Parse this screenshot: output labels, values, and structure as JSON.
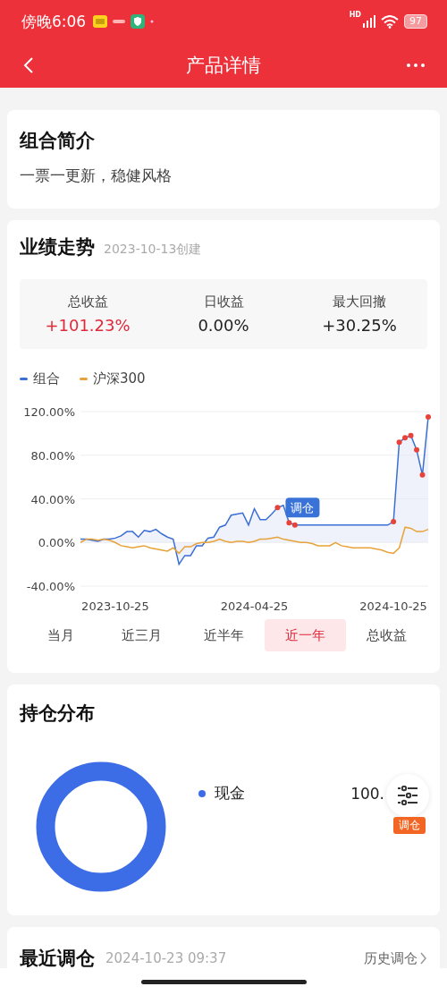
{
  "status_bar": {
    "time": "傍晚6:06",
    "network": "HD",
    "battery": "97"
  },
  "nav": {
    "title": "产品详情"
  },
  "intro": {
    "title": "组合简介",
    "text": "一票一更新，稳健风格"
  },
  "performance": {
    "title": "业绩走势",
    "created": "2023-10-13创建",
    "stats": [
      {
        "label": "总收益",
        "value": "+101.23%",
        "color": "#e0283a"
      },
      {
        "label": "日收益",
        "value": "0.00%",
        "color": "#222222"
      },
      {
        "label": "最大回撤",
        "value": "+30.25%",
        "color": "#222222"
      }
    ],
    "chart_data": {
      "type": "line",
      "categories": [
        null,
        null,
        null,
        null,
        null,
        null,
        "2023-10-25",
        null,
        null,
        null,
        null,
        null,
        null,
        null,
        null,
        null,
        null,
        null,
        null,
        null,
        null,
        null,
        null,
        null,
        null,
        null,
        null,
        null,
        null,
        null,
        "2024-04-25",
        null,
        null,
        null,
        null,
        null,
        null,
        null,
        null,
        null,
        null,
        null,
        null,
        null,
        null,
        null,
        null,
        null,
        null,
        null,
        null,
        null,
        null,
        null,
        "2024-10-25",
        null,
        null,
        null,
        null,
        null,
        null
      ],
      "series": [
        {
          "name": "组合",
          "color": "#3b6fd4",
          "values": [
            3,
            3,
            2,
            1,
            3,
            3,
            4,
            6,
            10,
            10,
            5,
            11,
            10,
            12,
            8,
            5,
            3,
            -20,
            -12,
            -12,
            -3,
            -3,
            4,
            5,
            14,
            16,
            25,
            26,
            27,
            16,
            31,
            21,
            21,
            26,
            32,
            34,
            18,
            16,
            16,
            16,
            16,
            16,
            16,
            16,
            16,
            16,
            16,
            16,
            16,
            16,
            16,
            16,
            16,
            16,
            19,
            92,
            96,
            98,
            85,
            62,
            115
          ]
        },
        {
          "name": "沪深300",
          "color": "#e8a23a",
          "values": [
            0,
            3,
            3,
            2,
            3,
            2,
            0,
            -3,
            -4,
            -5,
            -4,
            -3,
            -5,
            -6,
            -7,
            -8,
            -5,
            -10,
            -4,
            -4,
            -1,
            0,
            0,
            1,
            3,
            1,
            0,
            1,
            1,
            0,
            1,
            3,
            3,
            4,
            5,
            3,
            2,
            1,
            0,
            0,
            -1,
            -3,
            -3,
            -3,
            0,
            -3,
            -4,
            -5,
            -5,
            -5,
            -5,
            -6,
            -7,
            -9,
            -10,
            -5,
            14,
            13,
            10,
            10,
            12
          ]
        },
        {
          "name": "调仓",
          "type": "scatter",
          "color": "#e8433a",
          "values": [
            null,
            null,
            null,
            null,
            null,
            null,
            null,
            null,
            null,
            null,
            null,
            null,
            null,
            null,
            null,
            null,
            null,
            null,
            null,
            null,
            null,
            null,
            null,
            null,
            null,
            null,
            null,
            null,
            null,
            null,
            null,
            null,
            null,
            null,
            32,
            null,
            18,
            16,
            null,
            null,
            null,
            null,
            null,
            null,
            null,
            null,
            null,
            null,
            null,
            null,
            null,
            null,
            null,
            null,
            19,
            92,
            96,
            98,
            85,
            62,
            115
          ]
        }
      ],
      "ylim": [
        -40,
        120
      ],
      "grid": true,
      "yticks": [
        {
          "value": 120,
          "label": "120.00%"
        },
        {
          "value": 80,
          "label": "80.00%"
        },
        {
          "value": 40,
          "label": "40.00%"
        },
        {
          "value": 0,
          "label": "0.00%"
        },
        {
          "value": -40,
          "label": "-40.00%"
        }
      ]
    },
    "periods": [
      {
        "label": "当月",
        "selected": false
      },
      {
        "label": "近三月",
        "selected": false
      },
      {
        "label": "近半年",
        "selected": false
      },
      {
        "label": "近一年",
        "selected": true
      },
      {
        "label": "总收益",
        "selected": false
      }
    ]
  },
  "holdings": {
    "title": "持仓分布",
    "items": [
      {
        "name": "现金",
        "value": "100.",
        "color": "#3d6de6"
      }
    ],
    "fab_badge": "调仓"
  },
  "recent": {
    "title": "最近调仓",
    "time": "2024-10-23 09:37",
    "link": "历史调仓"
  }
}
